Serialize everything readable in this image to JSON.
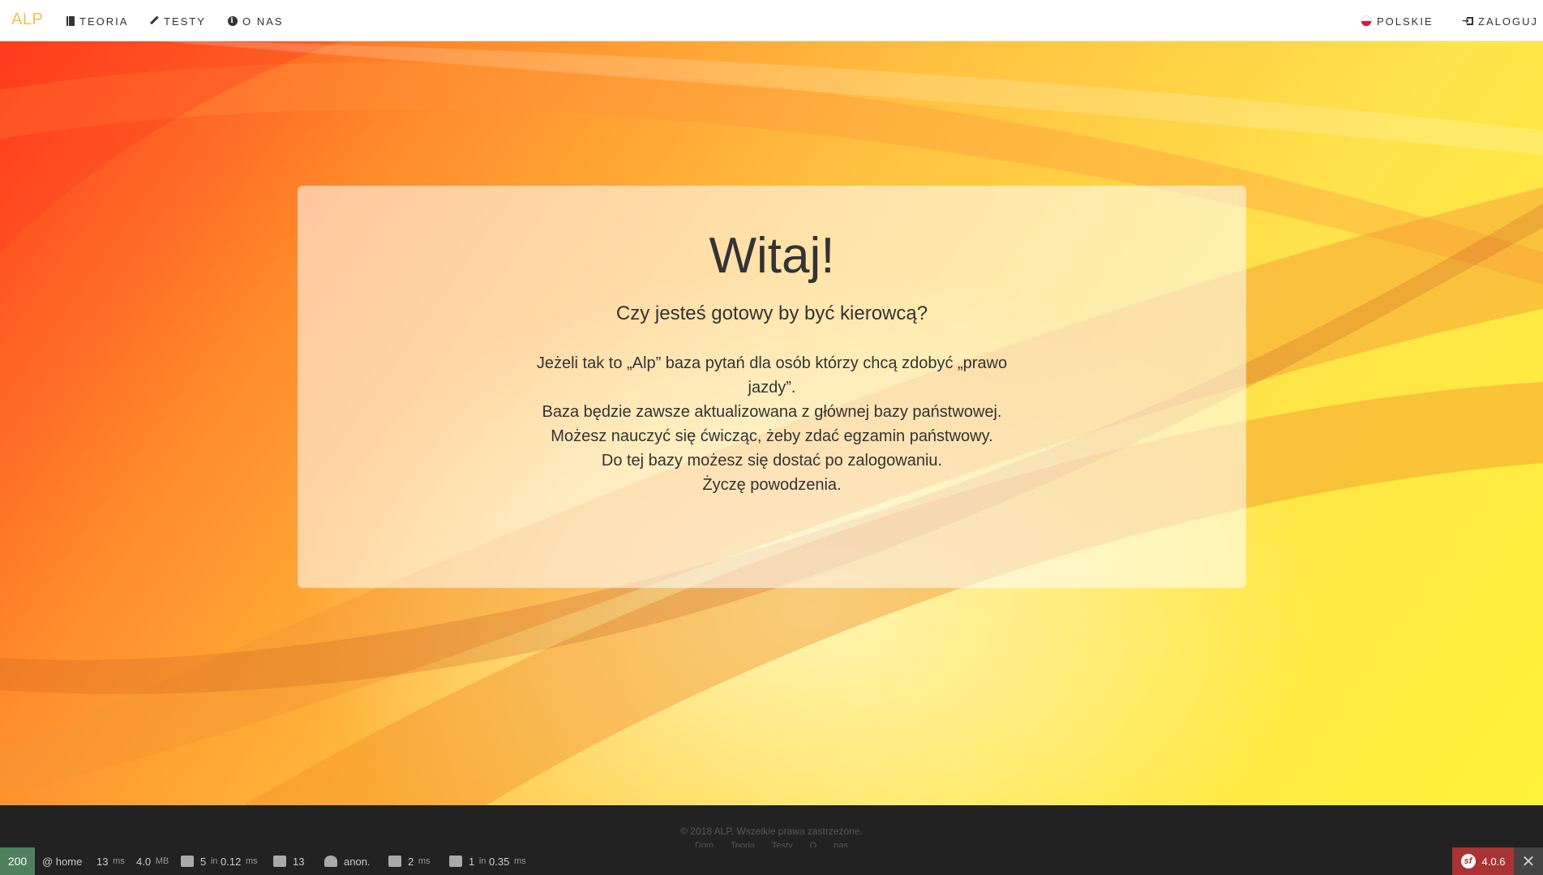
{
  "navbar": {
    "brand": "ALP",
    "items": [
      {
        "label": "TEORIA",
        "icon": "book-icon"
      },
      {
        "label": "TESTY",
        "icon": "pencil-icon"
      },
      {
        "label": "O NAS",
        "icon": "info-icon"
      }
    ],
    "language": {
      "label": "POLSKIE",
      "icon": "poland-flag-icon"
    },
    "login": {
      "label": "ZALOGUJ",
      "icon": "login-icon"
    }
  },
  "hero": {
    "title": "Witaj!",
    "lead": "Czy jesteś gotowy by być kierowcą?",
    "body_lines": [
      "Jeżeli tak to „Alp” baza pytań dla osób którzy chcą zdobyć „prawo jazdy”.",
      "Baza będzie zawsze aktualizowana z głównej bazy państwowej.",
      "Możesz nauczyć się ćwicząc, żeby zdać egzamin państwowy.",
      "Do tej bazy możesz się dostać po zalogowaniu."
    ],
    "wish": "Życzę powodzenia."
  },
  "footer": {
    "copyright": "© 2018 ALP. Wszelkie prawa zastrzeżone.",
    "links": [
      "Dom",
      "Teoria",
      "Testy",
      "O nas"
    ]
  },
  "debug_toolbar": {
    "status": "200",
    "route": "@ home",
    "time_value": "13",
    "time_unit": "ms",
    "memory_value": "4.0",
    "memory_unit": "MB",
    "forms": "5",
    "forms_in": "in",
    "forms_time": "0.12",
    "forms_unit": "ms",
    "translations": "13",
    "user": "anon.",
    "twig_time": "2",
    "twig_unit": "ms",
    "db_queries": "1",
    "db_in": "in",
    "db_time": "0.35",
    "db_unit": "ms",
    "symfony_version": "4.0.6",
    "colors": {
      "status_ok": "#4f805d",
      "symfony": "#aa3333"
    }
  }
}
